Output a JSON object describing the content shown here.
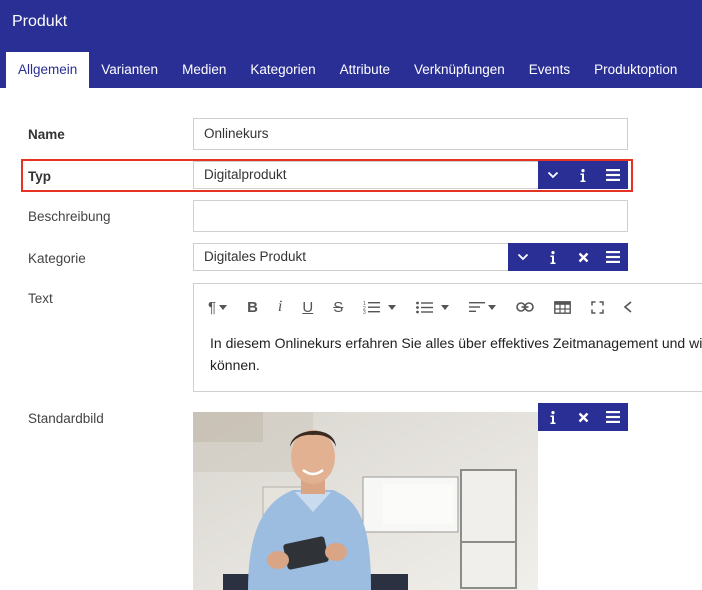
{
  "header": {
    "title": "Produkt",
    "tabs": [
      "Allgemein",
      "Varianten",
      "Medien",
      "Kategorien",
      "Attribute",
      "Verknüpfungen",
      "Events",
      "Produktoption"
    ]
  },
  "form": {
    "name": {
      "label": "Name",
      "value": "Onlinekurs"
    },
    "type": {
      "label": "Typ",
      "value": "Digitalprodukt"
    },
    "description": {
      "label": "Beschreibung",
      "value": ""
    },
    "category": {
      "label": "Kategorie",
      "value": "Digitales Produkt"
    },
    "text": {
      "label": "Text",
      "content": "In diesem Onlinekurs erfahren Sie alles über effektives Zeitmanagement und wi",
      "content_line2": "können."
    },
    "image": {
      "label": "Standardbild"
    }
  },
  "colors": {
    "primary": "#2a2f96",
    "highlight": "#e53222"
  },
  "icons": {
    "dropdown": "chevron-down-icon",
    "info": "info-icon",
    "clear": "close-icon",
    "menu": "menu-icon"
  }
}
